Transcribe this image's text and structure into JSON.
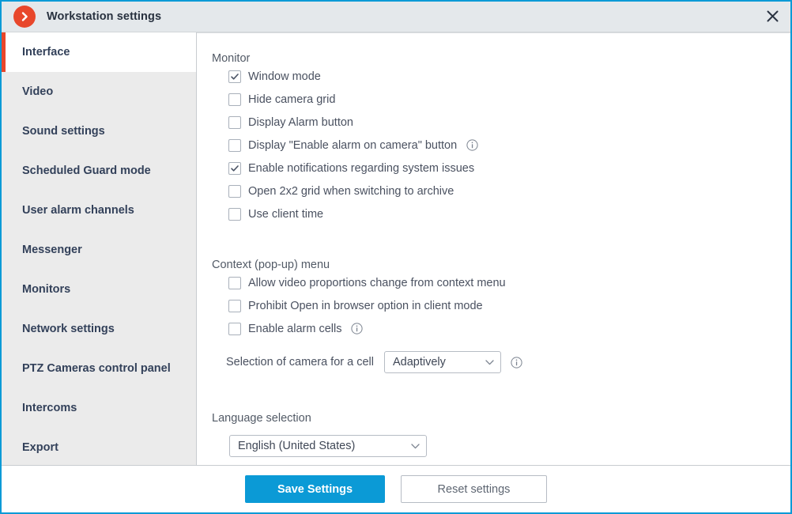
{
  "window": {
    "title": "Workstation settings",
    "logo_icon": "chevron-right-circle-icon",
    "close_icon": "close-icon",
    "border_color": "#0b9ad6",
    "accent_color": "#e8472b"
  },
  "sidebar": {
    "items": [
      {
        "label": "Interface",
        "active": true
      },
      {
        "label": "Video",
        "active": false
      },
      {
        "label": "Sound settings",
        "active": false
      },
      {
        "label": "Scheduled Guard mode",
        "active": false
      },
      {
        "label": "User alarm channels",
        "active": false
      },
      {
        "label": "Messenger",
        "active": false
      },
      {
        "label": "Monitors",
        "active": false
      },
      {
        "label": "Network settings",
        "active": false
      },
      {
        "label": "PTZ Cameras control panel",
        "active": false
      },
      {
        "label": "Intercoms",
        "active": false
      },
      {
        "label": "Export",
        "active": false
      }
    ]
  },
  "main": {
    "monitor": {
      "title": "Monitor",
      "options": [
        {
          "label": "Window mode",
          "checked": true,
          "info": false
        },
        {
          "label": "Hide camera grid",
          "checked": false,
          "info": false
        },
        {
          "label": "Display Alarm button",
          "checked": false,
          "info": false
        },
        {
          "label": "Display \"Enable alarm on camera\" button",
          "checked": false,
          "info": true
        },
        {
          "label": "Enable notifications regarding system issues",
          "checked": true,
          "info": false
        },
        {
          "label": "Open 2x2 grid when switching to archive",
          "checked": false,
          "info": false
        },
        {
          "label": "Use client time",
          "checked": false,
          "info": false
        }
      ]
    },
    "context_menu": {
      "title": "Context (pop-up) menu",
      "options": [
        {
          "label": "Allow video proportions change from context menu",
          "checked": false,
          "info": false
        },
        {
          "label": "Prohibit Open in browser option in client mode",
          "checked": false,
          "info": false
        },
        {
          "label": "Enable alarm cells",
          "checked": false,
          "info": true
        }
      ],
      "camera_selection": {
        "label": "Selection of camera for a cell",
        "value": "Adaptively",
        "info": true
      }
    },
    "language": {
      "title": "Language selection",
      "value": "English (United States)"
    }
  },
  "footer": {
    "save_label": "Save Settings",
    "reset_label": "Reset settings"
  }
}
